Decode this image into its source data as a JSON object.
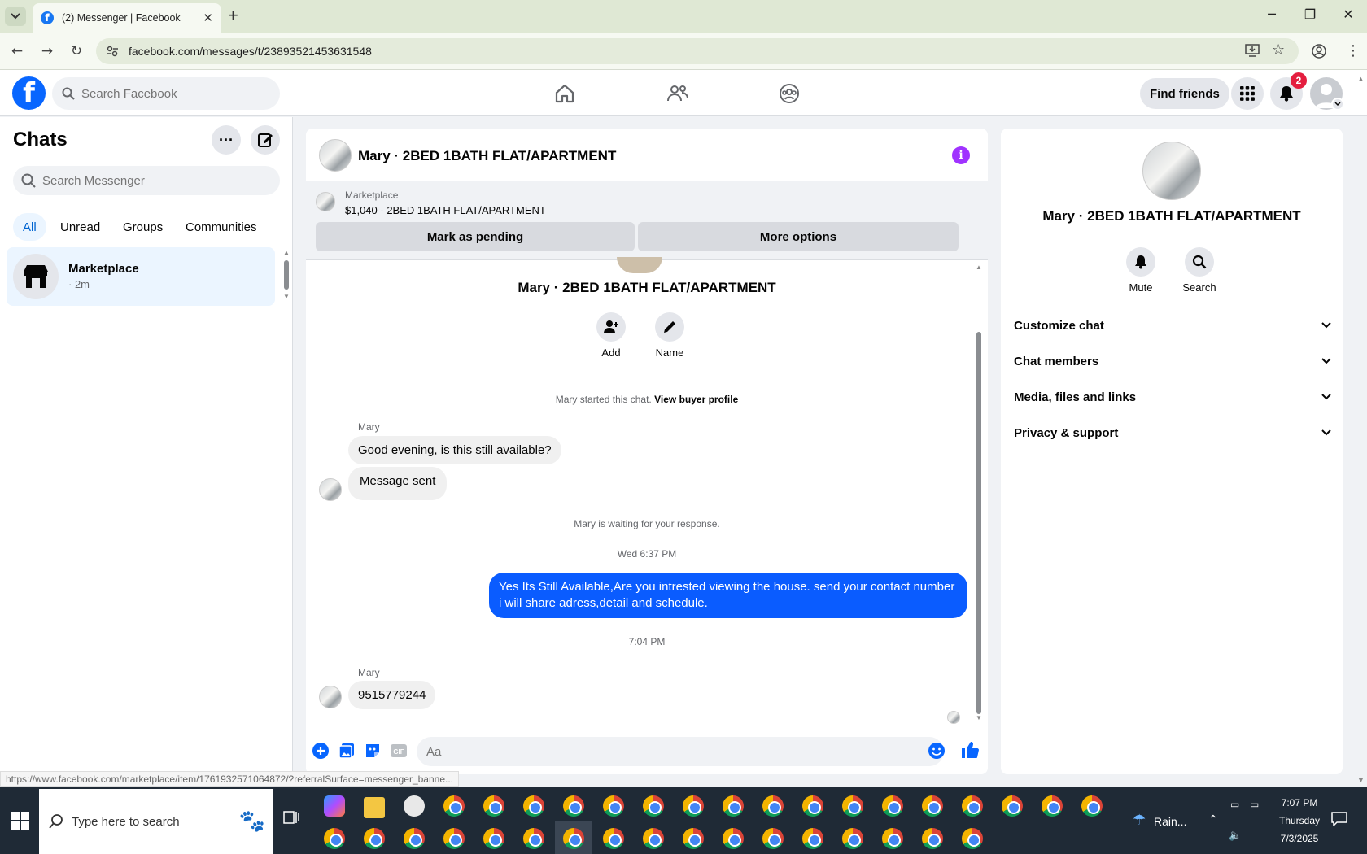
{
  "browser": {
    "tab_title": "(2) Messenger | Facebook",
    "url": "facebook.com/messages/t/23893521453631548",
    "status_url": "https://www.facebook.com/marketplace/item/1761932571064872/?referralSurface=messenger_banne..."
  },
  "header": {
    "search_placeholder": "Search Facebook",
    "find_friends": "Find friends",
    "notif_count": "2"
  },
  "sidebar": {
    "title": "Chats",
    "search_placeholder": "Search Messenger",
    "filters": [
      "All",
      "Unread",
      "Groups",
      "Communities"
    ],
    "chat_item": {
      "name": "Marketplace",
      "time": "· 2m"
    }
  },
  "conversation": {
    "title": "Mary · 2BED 1BATH FLAT/APARTMENT",
    "marketplace_label": "Marketplace",
    "marketplace_item": "$1,040 - 2BED 1BATH FLAT/APARTMENT",
    "mark_pending": "Mark as pending",
    "more_options": "More options",
    "add_label": "Add",
    "name_label": "Name",
    "started_text": "Mary started this chat.",
    "view_buyer": "View buyer profile",
    "sender1": "Mary",
    "msg1": "Good evening, is this still available?",
    "msg2": "Message sent",
    "waiting": "Mary is waiting for your response.",
    "ts1": "Wed 6:37 PM",
    "outgoing": "Yes Its Still Available,Are you intrested viewing the house. send your contact number i will share adress,detail and schedule.",
    "ts2": "7:04 PM",
    "sender2": "Mary",
    "msg3": "9515779244",
    "composer_placeholder": "Aa"
  },
  "right_panel": {
    "name": "Mary · 2BED 1BATH FLAT/APARTMENT",
    "mute": "Mute",
    "search": "Search",
    "rows": [
      "Customize chat",
      "Chat members",
      "Media, files and links",
      "Privacy & support"
    ]
  },
  "taskbar": {
    "search_placeholder": "Type here to search",
    "weather": "Rain...",
    "time": "7:07 PM",
    "day": "Thursday",
    "date": "7/3/2025"
  },
  "colors": {
    "fb_blue": "#0866ff",
    "message_blue": "#0a5cff",
    "info_purple": "#a033ff",
    "badge_red": "#e41e3f"
  }
}
